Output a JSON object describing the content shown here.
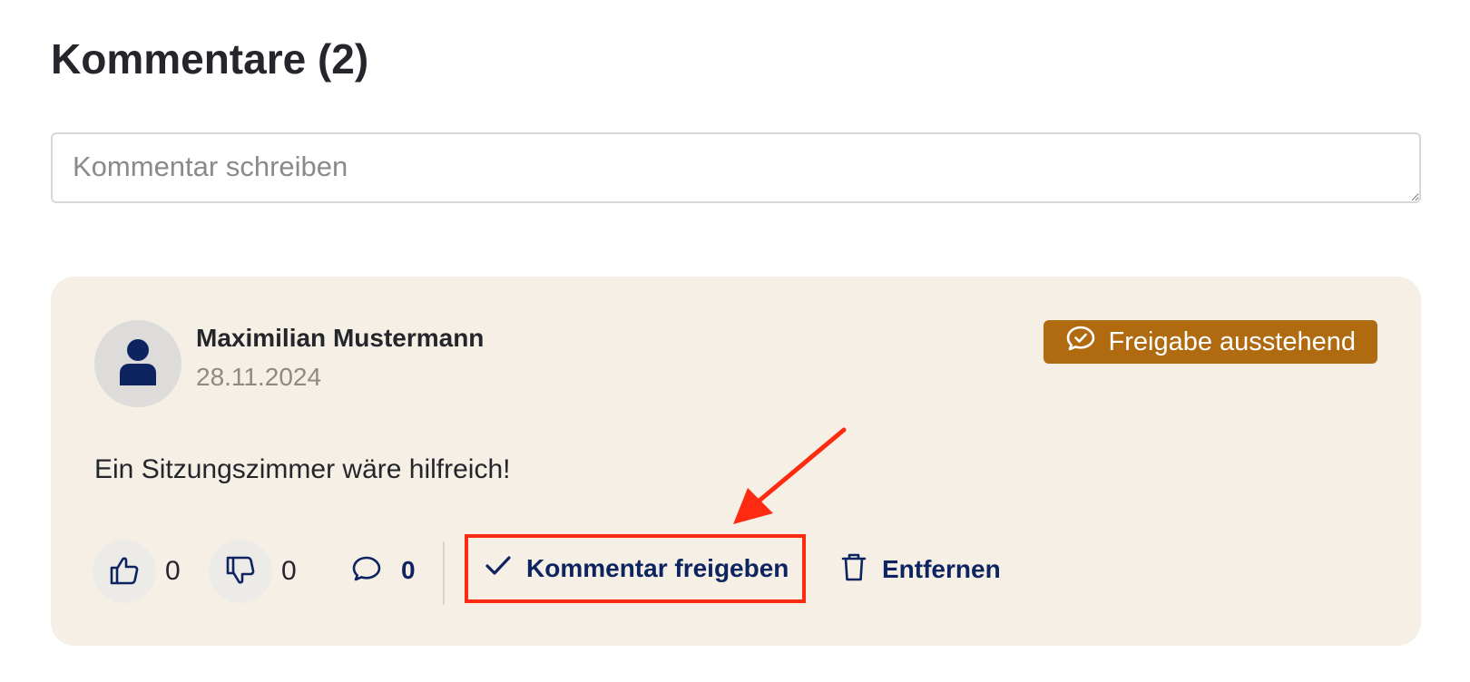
{
  "section": {
    "title": "Kommentare (2)"
  },
  "comment_input": {
    "placeholder": "Kommentar schreiben",
    "value": ""
  },
  "comment": {
    "author": "Maximilian Mustermann",
    "date": "28.11.2024",
    "status_label": "Freigabe ausstehend",
    "text": "Ein Sitzungszimmer wäre hilfreich!",
    "likes": "0",
    "dislikes": "0",
    "replies": "0",
    "approve_label": "Kommentar freigeben",
    "remove_label": "Entfernen"
  },
  "colors": {
    "navy": "#0d2460",
    "badge": "#b06a0f",
    "card_bg": "#f5efe6",
    "highlight": "#ff2a12"
  },
  "icons": {
    "avatar": "user-icon",
    "status": "chat-check-icon",
    "like": "thumbs-up-icon",
    "dislike": "thumbs-down-icon",
    "reply": "chat-bubble-icon",
    "approve": "checkmark-icon",
    "remove": "trash-icon"
  }
}
